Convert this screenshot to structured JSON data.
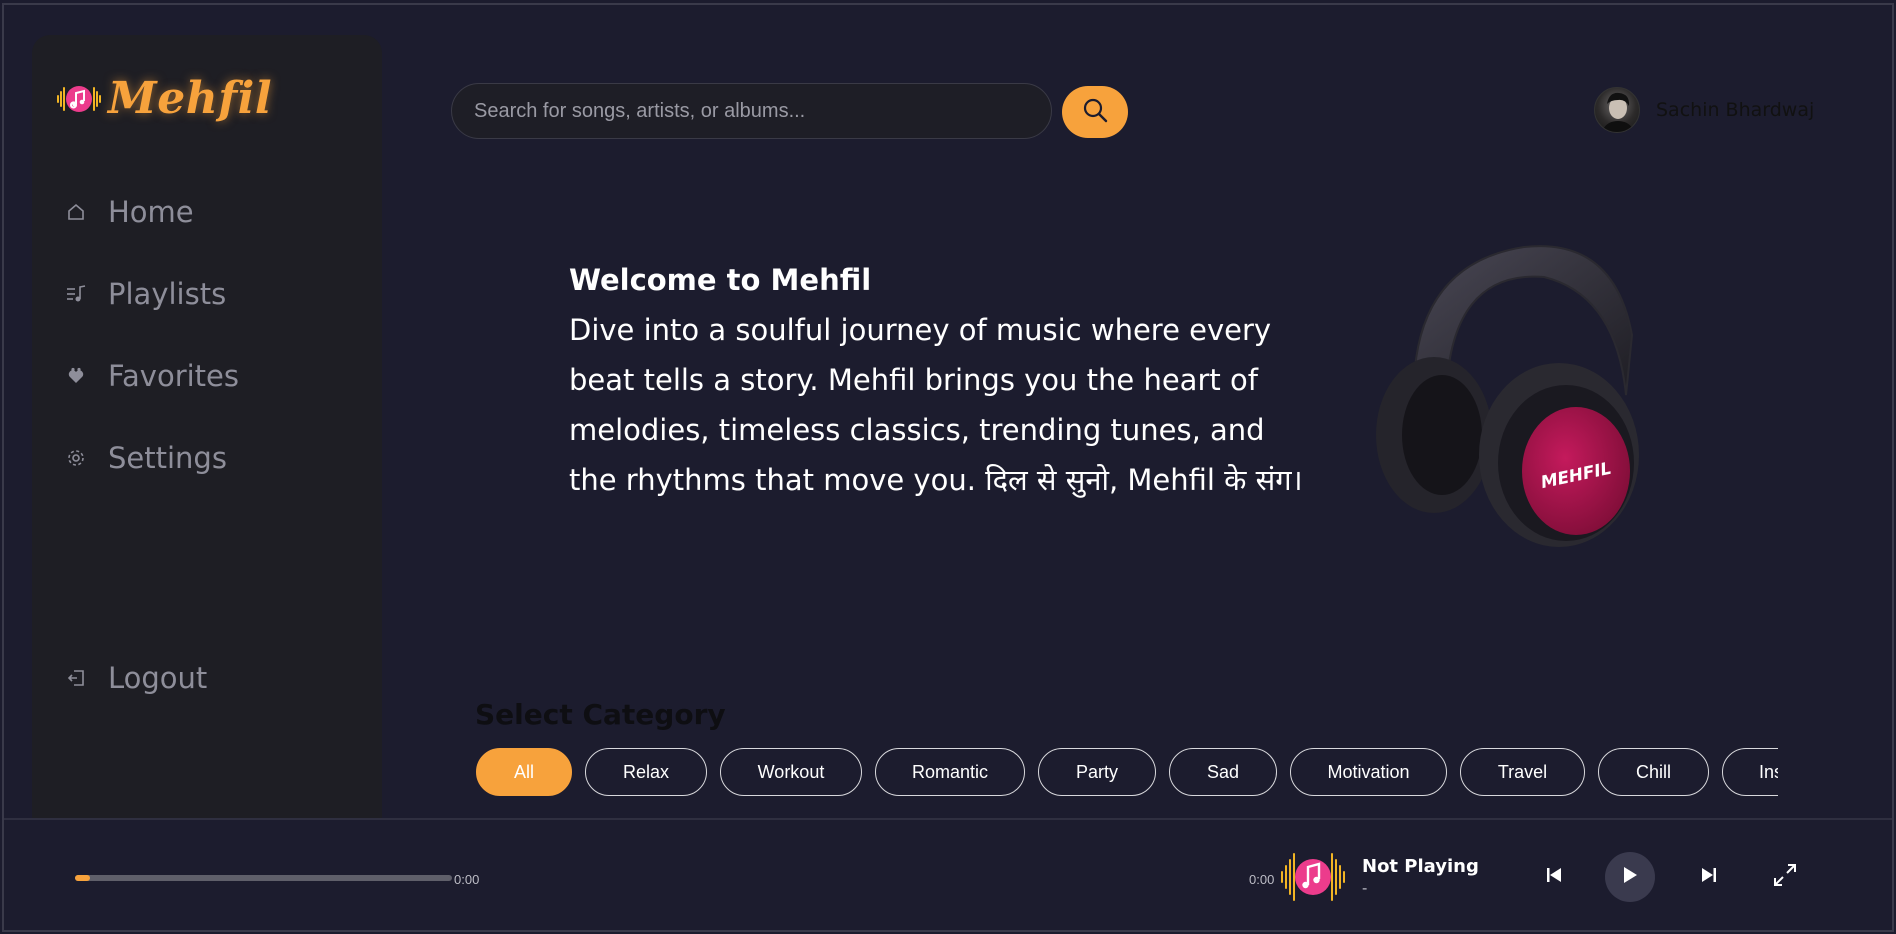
{
  "app": {
    "name": "Mehfil"
  },
  "sidebar": {
    "items": [
      {
        "label": "Home",
        "icon": "home-icon"
      },
      {
        "label": "Playlists",
        "icon": "playlist-icon"
      },
      {
        "label": "Favorites",
        "icon": "heart-icon"
      },
      {
        "label": "Settings",
        "icon": "gear-icon"
      }
    ],
    "logout": {
      "label": "Logout",
      "icon": "logout-icon"
    }
  },
  "search": {
    "placeholder": "Search for songs, artists, or albums...",
    "value": ""
  },
  "user": {
    "name": "Sachin Bhardwaj"
  },
  "hero": {
    "title": "Welcome to Mehfil",
    "text": "Dive into a soulful journey of music where every beat tells a story. Mehfil brings you the heart of melodies, timeless classics, trending tunes, and the rhythms that move you. दिल से सुनो, Mehfil के संग।",
    "image_label": "MEHFIL"
  },
  "categories": {
    "title": "Select Category",
    "items": [
      "All",
      "Relax",
      "Workout",
      "Romantic",
      "Party",
      "Sad",
      "Motivation",
      "Travel",
      "Chill",
      "Ins"
    ],
    "selected": "All"
  },
  "player": {
    "current_time": "0:00",
    "duration": "0:00",
    "progress": 0.04,
    "track_title": "Not Playing",
    "track_artist": "-"
  },
  "colors": {
    "accent": "#f7a23c",
    "background": "#1c1c2e",
    "sidebar": "#1e1e24",
    "logo_pink": "#ec3c8c"
  }
}
